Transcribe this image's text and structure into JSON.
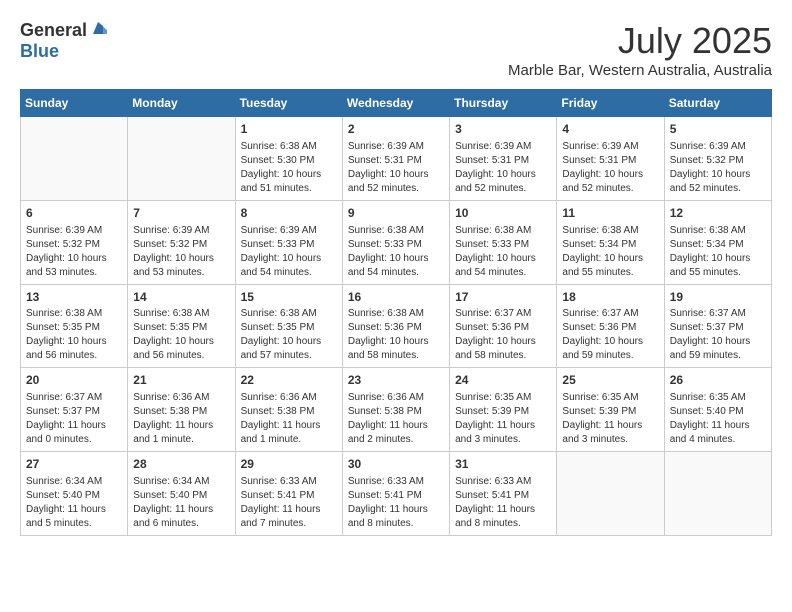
{
  "logo": {
    "general": "General",
    "blue": "Blue"
  },
  "header": {
    "month_year": "July 2025",
    "location": "Marble Bar, Western Australia, Australia"
  },
  "days_of_week": [
    "Sunday",
    "Monday",
    "Tuesday",
    "Wednesday",
    "Thursday",
    "Friday",
    "Saturday"
  ],
  "weeks": [
    [
      {
        "day": "",
        "info": ""
      },
      {
        "day": "",
        "info": ""
      },
      {
        "day": "1",
        "info": "Sunrise: 6:38 AM\nSunset: 5:30 PM\nDaylight: 10 hours and 51 minutes."
      },
      {
        "day": "2",
        "info": "Sunrise: 6:39 AM\nSunset: 5:31 PM\nDaylight: 10 hours and 52 minutes."
      },
      {
        "day": "3",
        "info": "Sunrise: 6:39 AM\nSunset: 5:31 PM\nDaylight: 10 hours and 52 minutes."
      },
      {
        "day": "4",
        "info": "Sunrise: 6:39 AM\nSunset: 5:31 PM\nDaylight: 10 hours and 52 minutes."
      },
      {
        "day": "5",
        "info": "Sunrise: 6:39 AM\nSunset: 5:32 PM\nDaylight: 10 hours and 52 minutes."
      }
    ],
    [
      {
        "day": "6",
        "info": "Sunrise: 6:39 AM\nSunset: 5:32 PM\nDaylight: 10 hours and 53 minutes."
      },
      {
        "day": "7",
        "info": "Sunrise: 6:39 AM\nSunset: 5:32 PM\nDaylight: 10 hours and 53 minutes."
      },
      {
        "day": "8",
        "info": "Sunrise: 6:39 AM\nSunset: 5:33 PM\nDaylight: 10 hours and 54 minutes."
      },
      {
        "day": "9",
        "info": "Sunrise: 6:38 AM\nSunset: 5:33 PM\nDaylight: 10 hours and 54 minutes."
      },
      {
        "day": "10",
        "info": "Sunrise: 6:38 AM\nSunset: 5:33 PM\nDaylight: 10 hours and 54 minutes."
      },
      {
        "day": "11",
        "info": "Sunrise: 6:38 AM\nSunset: 5:34 PM\nDaylight: 10 hours and 55 minutes."
      },
      {
        "day": "12",
        "info": "Sunrise: 6:38 AM\nSunset: 5:34 PM\nDaylight: 10 hours and 55 minutes."
      }
    ],
    [
      {
        "day": "13",
        "info": "Sunrise: 6:38 AM\nSunset: 5:35 PM\nDaylight: 10 hours and 56 minutes."
      },
      {
        "day": "14",
        "info": "Sunrise: 6:38 AM\nSunset: 5:35 PM\nDaylight: 10 hours and 56 minutes."
      },
      {
        "day": "15",
        "info": "Sunrise: 6:38 AM\nSunset: 5:35 PM\nDaylight: 10 hours and 57 minutes."
      },
      {
        "day": "16",
        "info": "Sunrise: 6:38 AM\nSunset: 5:36 PM\nDaylight: 10 hours and 58 minutes."
      },
      {
        "day": "17",
        "info": "Sunrise: 6:37 AM\nSunset: 5:36 PM\nDaylight: 10 hours and 58 minutes."
      },
      {
        "day": "18",
        "info": "Sunrise: 6:37 AM\nSunset: 5:36 PM\nDaylight: 10 hours and 59 minutes."
      },
      {
        "day": "19",
        "info": "Sunrise: 6:37 AM\nSunset: 5:37 PM\nDaylight: 10 hours and 59 minutes."
      }
    ],
    [
      {
        "day": "20",
        "info": "Sunrise: 6:37 AM\nSunset: 5:37 PM\nDaylight: 11 hours and 0 minutes."
      },
      {
        "day": "21",
        "info": "Sunrise: 6:36 AM\nSunset: 5:38 PM\nDaylight: 11 hours and 1 minute."
      },
      {
        "day": "22",
        "info": "Sunrise: 6:36 AM\nSunset: 5:38 PM\nDaylight: 11 hours and 1 minute."
      },
      {
        "day": "23",
        "info": "Sunrise: 6:36 AM\nSunset: 5:38 PM\nDaylight: 11 hours and 2 minutes."
      },
      {
        "day": "24",
        "info": "Sunrise: 6:35 AM\nSunset: 5:39 PM\nDaylight: 11 hours and 3 minutes."
      },
      {
        "day": "25",
        "info": "Sunrise: 6:35 AM\nSunset: 5:39 PM\nDaylight: 11 hours and 3 minutes."
      },
      {
        "day": "26",
        "info": "Sunrise: 6:35 AM\nSunset: 5:40 PM\nDaylight: 11 hours and 4 minutes."
      }
    ],
    [
      {
        "day": "27",
        "info": "Sunrise: 6:34 AM\nSunset: 5:40 PM\nDaylight: 11 hours and 5 minutes."
      },
      {
        "day": "28",
        "info": "Sunrise: 6:34 AM\nSunset: 5:40 PM\nDaylight: 11 hours and 6 minutes."
      },
      {
        "day": "29",
        "info": "Sunrise: 6:33 AM\nSunset: 5:41 PM\nDaylight: 11 hours and 7 minutes."
      },
      {
        "day": "30",
        "info": "Sunrise: 6:33 AM\nSunset: 5:41 PM\nDaylight: 11 hours and 8 minutes."
      },
      {
        "day": "31",
        "info": "Sunrise: 6:33 AM\nSunset: 5:41 PM\nDaylight: 11 hours and 8 minutes."
      },
      {
        "day": "",
        "info": ""
      },
      {
        "day": "",
        "info": ""
      }
    ]
  ]
}
